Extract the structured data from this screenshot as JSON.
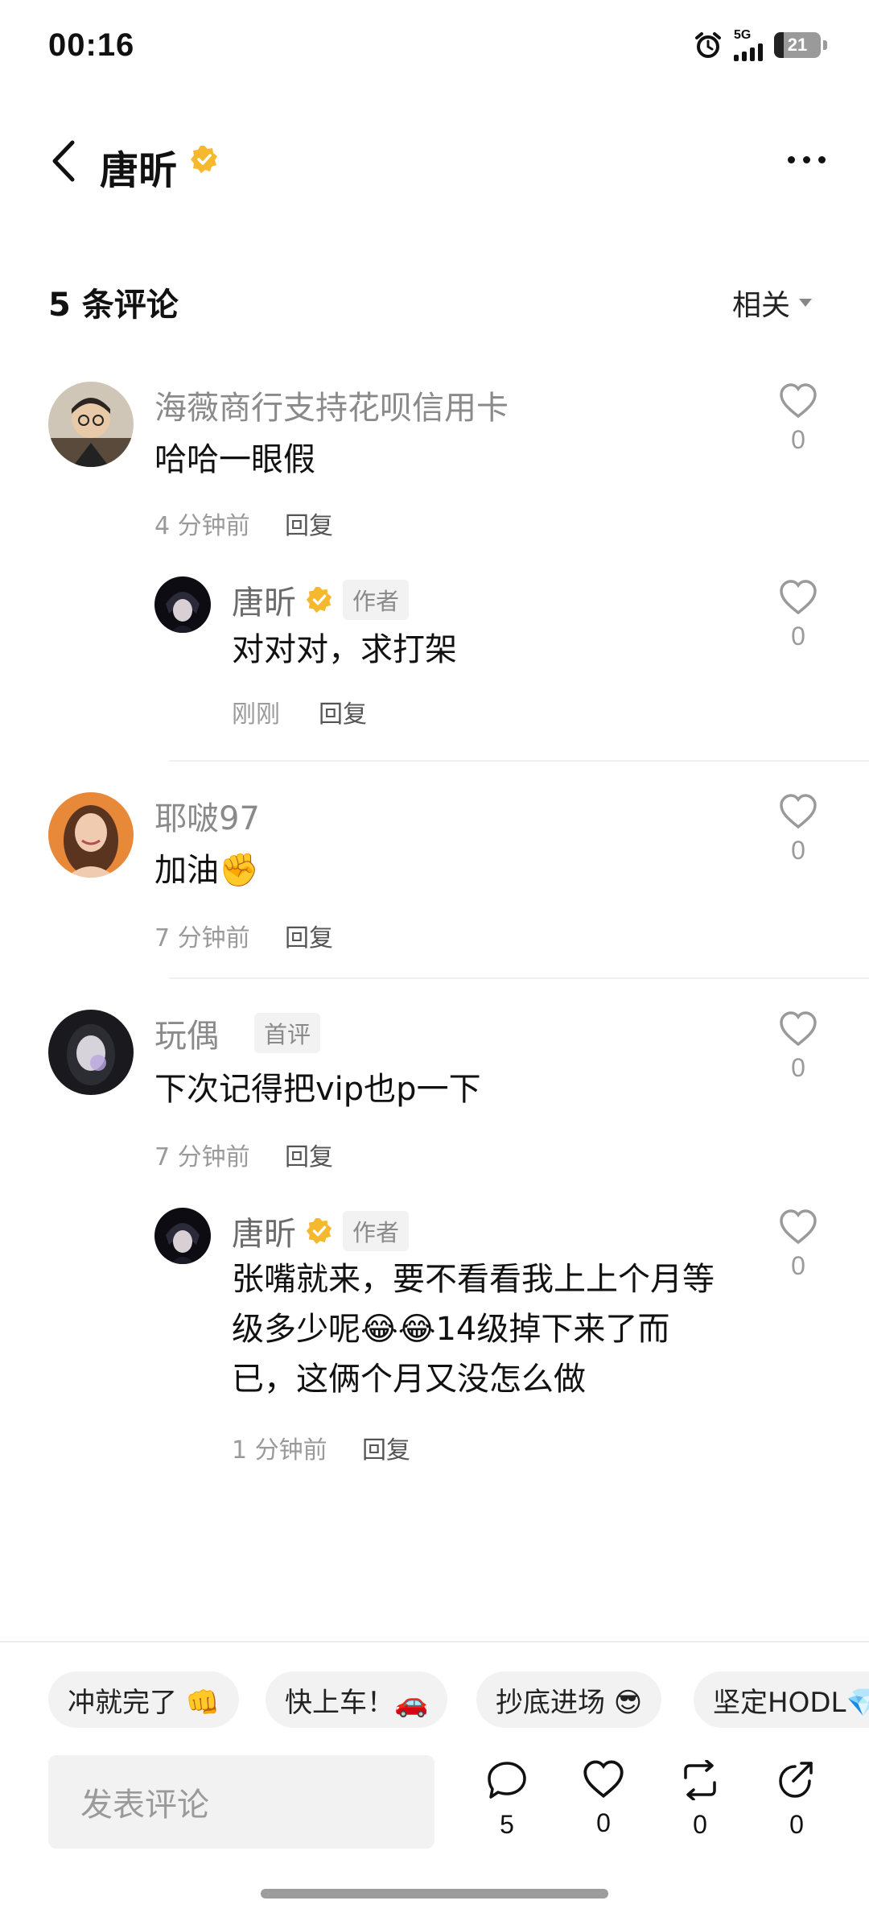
{
  "status_bar": {
    "time": "00:16",
    "network": "5G",
    "battery": "21"
  },
  "header": {
    "title": "唐昕"
  },
  "comments_header": {
    "count_text": "5 条评论",
    "sort_label": "相关"
  },
  "comments": [
    {
      "name": "海薇商行支持花呗信用卡",
      "text": "哈哈一眼假",
      "time": "4 分钟前",
      "reply_label": "回复",
      "likes": "0",
      "replies": [
        {
          "name": "唐昕",
          "tag": "作者",
          "text": "对对对，求打架",
          "time": "刚刚",
          "reply_label": "回复",
          "likes": "0"
        }
      ]
    },
    {
      "name": "耶啵97",
      "text": "加油✊",
      "time": "7 分钟前",
      "reply_label": "回复",
      "likes": "0"
    },
    {
      "name": "玩偶",
      "tag": "首评",
      "text": "下次记得把vip也p一下",
      "time": "7 分钟前",
      "reply_label": "回复",
      "likes": "0",
      "replies": [
        {
          "name": "唐昕",
          "tag": "作者",
          "text_lines": [
            "张嘴就来，要不看看我上上个月等",
            "级多少呢😂😂14级掉下来了而",
            "已，这俩个月又没怎么做"
          ],
          "time": "1 分钟前",
          "reply_label": "回复",
          "likes": "0"
        }
      ]
    }
  ],
  "quick_replies": [
    "冲就完了 👊",
    "快上车！🚗",
    "抄底进场 😎",
    "坚定HODL💎"
  ],
  "bottom_bar": {
    "input_placeholder": "发表评论",
    "comment_count": "5",
    "like_count": "0",
    "repost_count": "0",
    "share_count": "0"
  },
  "colors": {
    "verified": "#f5b82e",
    "text_primary": "#111111",
    "text_secondary": "#8a8a8a"
  }
}
